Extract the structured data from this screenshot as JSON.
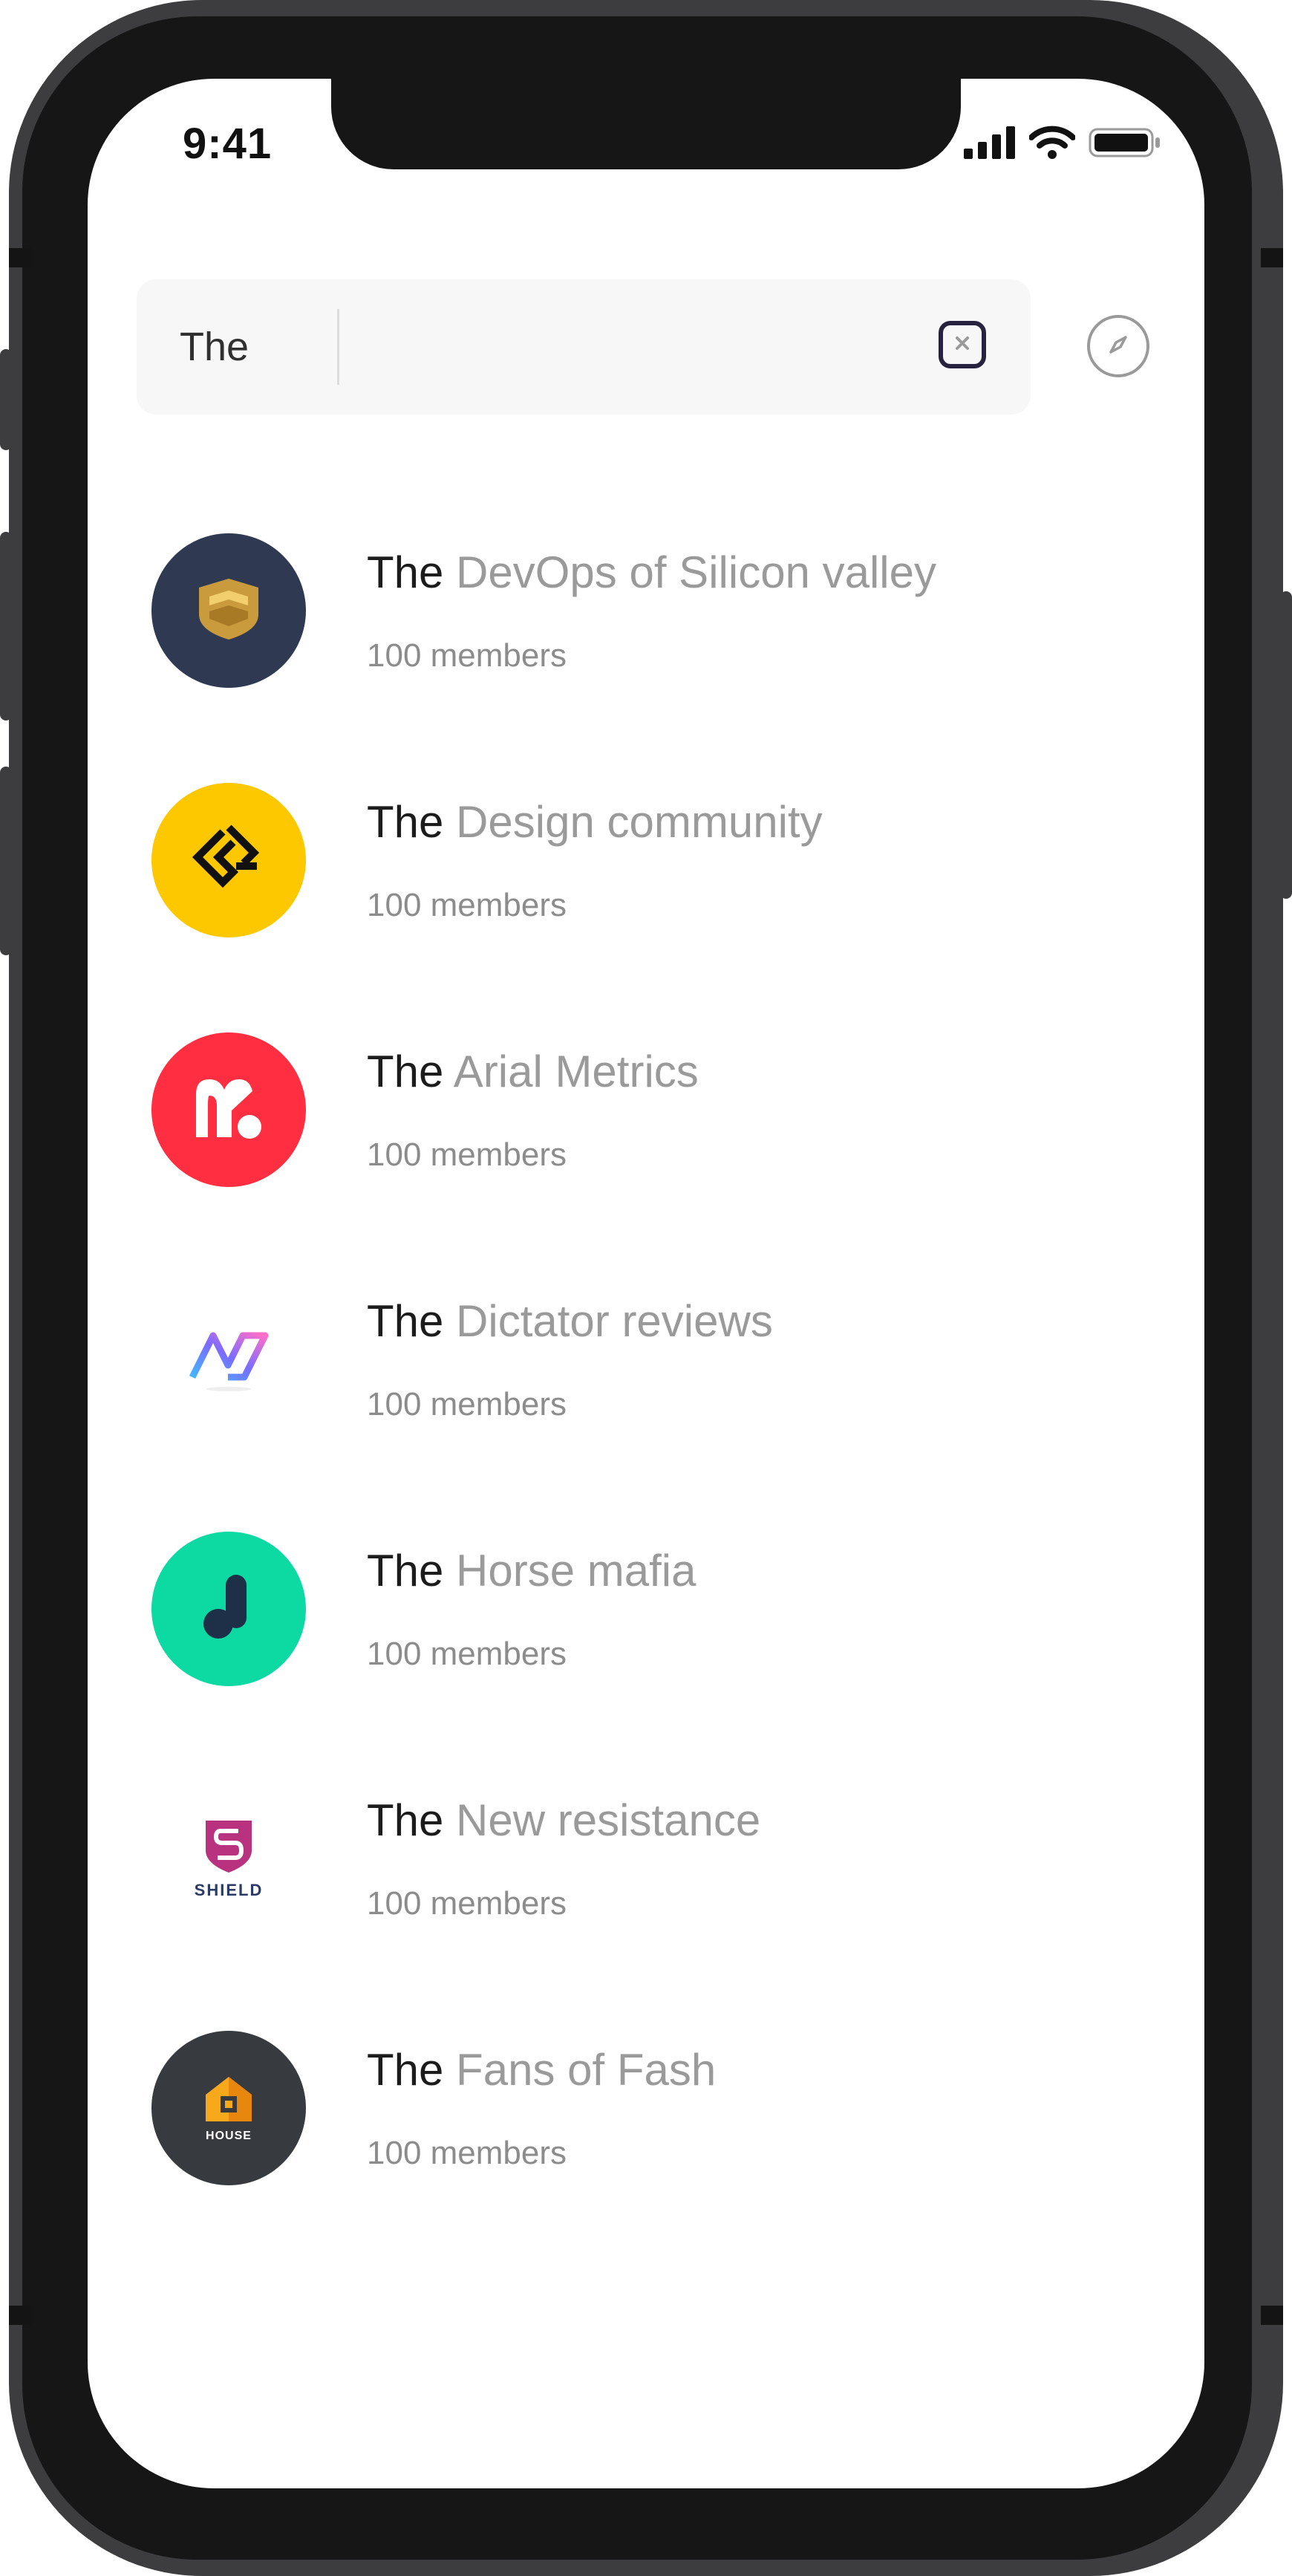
{
  "status_bar": {
    "time": "9:41"
  },
  "search": {
    "query": "The"
  },
  "groups": [
    {
      "match": "The",
      "rest": " DevOps of Silicon valley",
      "members": "100 members",
      "logo": "shield-crest-logo",
      "bg": "#2f3a52"
    },
    {
      "match": "The",
      "rest": " Design community",
      "members": "100 members",
      "logo": "diamond-arrow-logo",
      "bg": "#fdc800"
    },
    {
      "match": "The",
      "rest": " Arial Metrics",
      "members": "100 members",
      "logo": "m-letter-logo",
      "bg": "#ff2e40"
    },
    {
      "match": "The",
      "rest": " Dictator reviews",
      "members": "100 members",
      "logo": "gradient-n-logo",
      "bg": "#ffffff"
    },
    {
      "match": "The",
      "rest": " Horse mafia",
      "members": "100 members",
      "logo": "j-letter-logo",
      "bg": "#0ddaa2"
    },
    {
      "match": "The",
      "rest": " New resistance",
      "members": "100 members",
      "logo": "shield-logo",
      "logo_text": "SHIELD",
      "bg": "#ffffff"
    },
    {
      "match": "The",
      "rest": " Fans of Fash",
      "members": "100 members",
      "logo": "house-logo",
      "logo_text": "HOUSE",
      "bg": "#373a3e"
    }
  ]
}
